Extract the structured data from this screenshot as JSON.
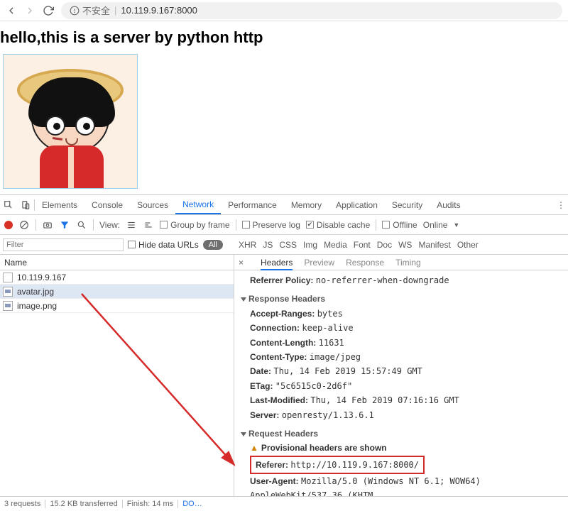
{
  "addressbar": {
    "insecure_label": "不安全",
    "url": "10.119.9.167:8000"
  },
  "page": {
    "heading": "hello,this is a server by python http"
  },
  "devtools": {
    "main_tabs": [
      "Elements",
      "Console",
      "Sources",
      "Network",
      "Performance",
      "Memory",
      "Application",
      "Security",
      "Audits"
    ],
    "active_main_tab": "Network",
    "toolbar": {
      "view_label": "View:",
      "group_by_frame": "Group by frame",
      "preserve_log": "Preserve log",
      "disable_cache": "Disable cache",
      "offline": "Offline",
      "online": "Online",
      "disable_cache_checked": true
    },
    "filter": {
      "placeholder": "Filter",
      "hide_data_urls": "Hide data URLs",
      "all_label": "All",
      "types": [
        "XHR",
        "JS",
        "CSS",
        "Img",
        "Media",
        "Font",
        "Doc",
        "WS",
        "Manifest",
        "Other"
      ]
    },
    "requests": {
      "name_header": "Name",
      "items": [
        "10.119.9.167",
        "avatar.jpg",
        "image.png"
      ],
      "selected": "avatar.jpg"
    },
    "detail_tabs": [
      "Headers",
      "Preview",
      "Response",
      "Timing"
    ],
    "active_detail_tab": "Headers",
    "headers": {
      "referrer_policy_k": "Referrer Policy:",
      "referrer_policy_v": "no-referrer-when-downgrade",
      "response_section": "Response Headers",
      "response": [
        {
          "k": "Accept-Ranges:",
          "v": "bytes"
        },
        {
          "k": "Connection:",
          "v": "keep-alive"
        },
        {
          "k": "Content-Length:",
          "v": "11631"
        },
        {
          "k": "Content-Type:",
          "v": "image/jpeg"
        },
        {
          "k": "Date:",
          "v": "Thu, 14 Feb 2019 15:57:49 GMT"
        },
        {
          "k": "ETag:",
          "v": "\"5c6515c0-2d6f\""
        },
        {
          "k": "Last-Modified:",
          "v": "Thu, 14 Feb 2019 07:16:16 GMT"
        },
        {
          "k": "Server:",
          "v": "openresty/1.13.6.1"
        }
      ],
      "request_section": "Request Headers",
      "provisional": "Provisional headers are shown",
      "referer_k": "Referer:",
      "referer_v": "http://10.119.9.167:8000/",
      "ua_k": "User-Agent:",
      "ua_v": "Mozilla/5.0 (Windows NT 6.1; WOW64) AppleWebKit/537.36 (KHTM"
    },
    "status": {
      "requests": "3 requests",
      "transferred": "15.2 KB transferred",
      "finish": "Finish: 14 ms",
      "dom": "DO…"
    }
  }
}
